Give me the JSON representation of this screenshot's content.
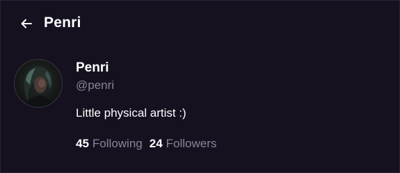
{
  "header": {
    "title": "Penri",
    "back_icon": "arrow-left-icon"
  },
  "profile": {
    "display_name": "Penri",
    "handle": "@penri",
    "bio": "Little physical artist :)",
    "avatar": "avatar-photo"
  },
  "stats": {
    "following_count": "45",
    "following_label": "Following",
    "followers_count": "24",
    "followers_label": "Followers"
  },
  "colors": {
    "background": "#15111f",
    "text_primary": "#ffffff",
    "text_muted": "#8a8598"
  }
}
